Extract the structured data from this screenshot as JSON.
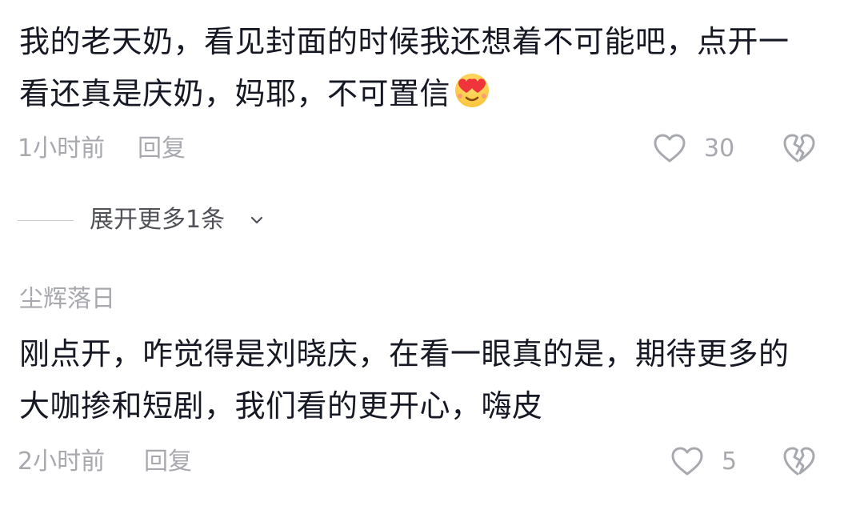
{
  "comments": [
    {
      "username": "",
      "text": "我的老天奶，看见封面的时候我还想着不可能吧，点开一看还真是庆奶，妈耶，不可置信",
      "emoji": "heart-eyes-emoji",
      "time": "1小时前",
      "reply_label": "回复",
      "like_count": "30"
    },
    {
      "username": "尘辉落日",
      "text": "刚点开，咋觉得是刘晓庆，在看一眼真的是，期待更多的大咖掺和短剧，我们看的更开心，嗨皮",
      "time": "2小时前",
      "reply_label": "回复",
      "like_count": "5"
    }
  ],
  "expand_replies_label": "展开更多1条",
  "icons": {
    "like": "heart-outline-icon",
    "dislike": "broken-heart-icon",
    "expand": "chevron-down-icon"
  },
  "colors": {
    "text_primary": "#161823",
    "text_secondary": "#a8a9ae",
    "expand_text": "#505258"
  }
}
